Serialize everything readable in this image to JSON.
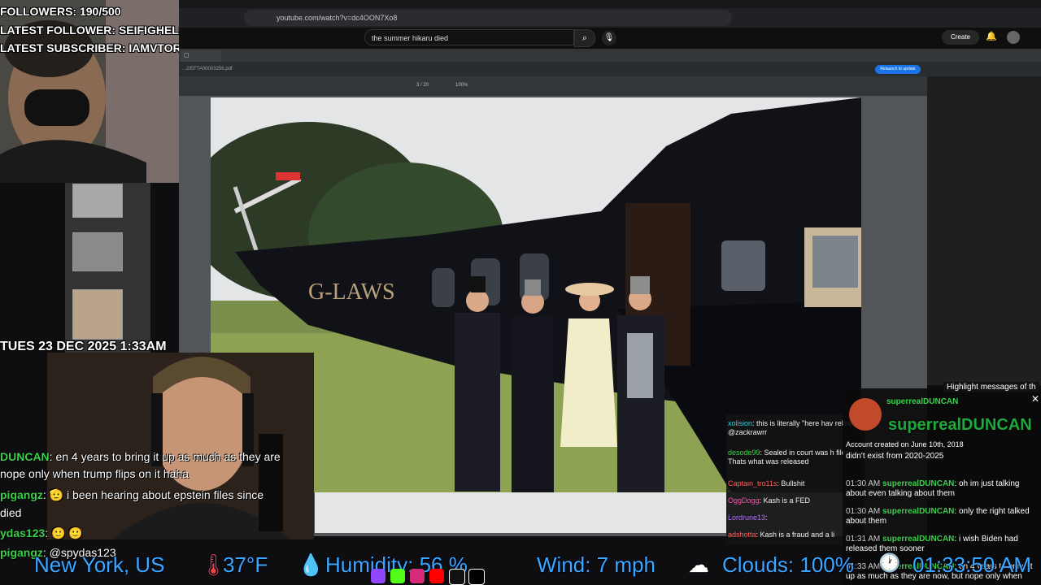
{
  "browser": {
    "url": "youtube.com/watch?v=dc4OON7Xo8",
    "search_query": "the summer hikaru died",
    "create_label": "Create"
  },
  "pdf": {
    "page_indicator": "3 / 20",
    "zoom": "100%",
    "relaunch_label": "Relaunch to update",
    "file_path": "...2/EFTA00003256.pdf"
  },
  "photo": {
    "helicopter_text": "G-LAWS"
  },
  "overlay": {
    "followers": "FOLLOWERS: 190/500",
    "latest_follower": "LATEST FOLLOWER: SEIFIGHELI",
    "latest_subscriber": "LATEST SUBSCRIBER: IAMVTOR",
    "datetime": "TUES 23 DEC 2025 1:33AM"
  },
  "left_chat": [
    {
      "name": "DUNCAN",
      "text": ": en 4 years to bring it up as much as they are"
    },
    {
      "name": "",
      "text": "nope only when trump flips on it haha"
    },
    {
      "name": "pigangz",
      "text": ": 🫡 i been hearing about epstein files since"
    },
    {
      "name": "",
      "text": "died"
    },
    {
      "name": "ydas123",
      "text": ": 🙂 🙂"
    },
    {
      "name": "pigangz",
      "text": ": @spydas123"
    }
  ],
  "mid_chat": [
    {
      "name": "xolision",
      "color": "#2ed3e6",
      "text": ": this is literally \"here hav release @zackrawrr"
    },
    {
      "name": "desode99",
      "color": "#3ad04a",
      "text": ": Sealed in court was h files. Thats what was released"
    },
    {
      "name": "Captain_tro11s",
      "color": "#ff5a5a",
      "text": ": Bullshit"
    },
    {
      "name": "OggDogg",
      "color": "#ff4fb0",
      "text": ": Kash is a FED"
    },
    {
      "name": "Lordrune13",
      "color": "#b46bff",
      "text": ":"
    },
    {
      "name": "adshotta",
      "color": "#ff5a5a",
      "text": ": Kash is a fraud and a li"
    }
  ],
  "highlight": {
    "banner": "Highlight messages of th",
    "username": "superrealDUNCAN",
    "big_name": "superrealDUNCAN",
    "created": "Account created on June 10th, 2018",
    "first_line": "didn't exist from 2020-2025"
  },
  "right_chat": [
    {
      "time": "01:30 AM",
      "name": "superrealDUNCAN",
      "text": ": oh im just talking about even talking about them"
    },
    {
      "time": "01:30 AM",
      "name": "superrealDUNCAN",
      "text": ": only the right talked about them"
    },
    {
      "time": "01:31 AM",
      "name": "superrealDUNCAN",
      "text": ": i wish Biden had released them sooner"
    },
    {
      "time": "01:33 AM",
      "name": "superrealDUNCAN",
      "text": ": en 4 years to bring it up as much as they are now, but nope only when"
    }
  ],
  "weather": {
    "location": "New York, US",
    "temperature": "37°F",
    "humidity": "Humidity: 56 %",
    "wind": "Wind: 7 mph",
    "clouds": "Clouds: 100%",
    "clock": "01:33:50 AM"
  },
  "colors": {
    "chat_name_green": "#3ad04a",
    "weather_blue": "#3aa8ff",
    "helicopter_black": "#101218"
  }
}
